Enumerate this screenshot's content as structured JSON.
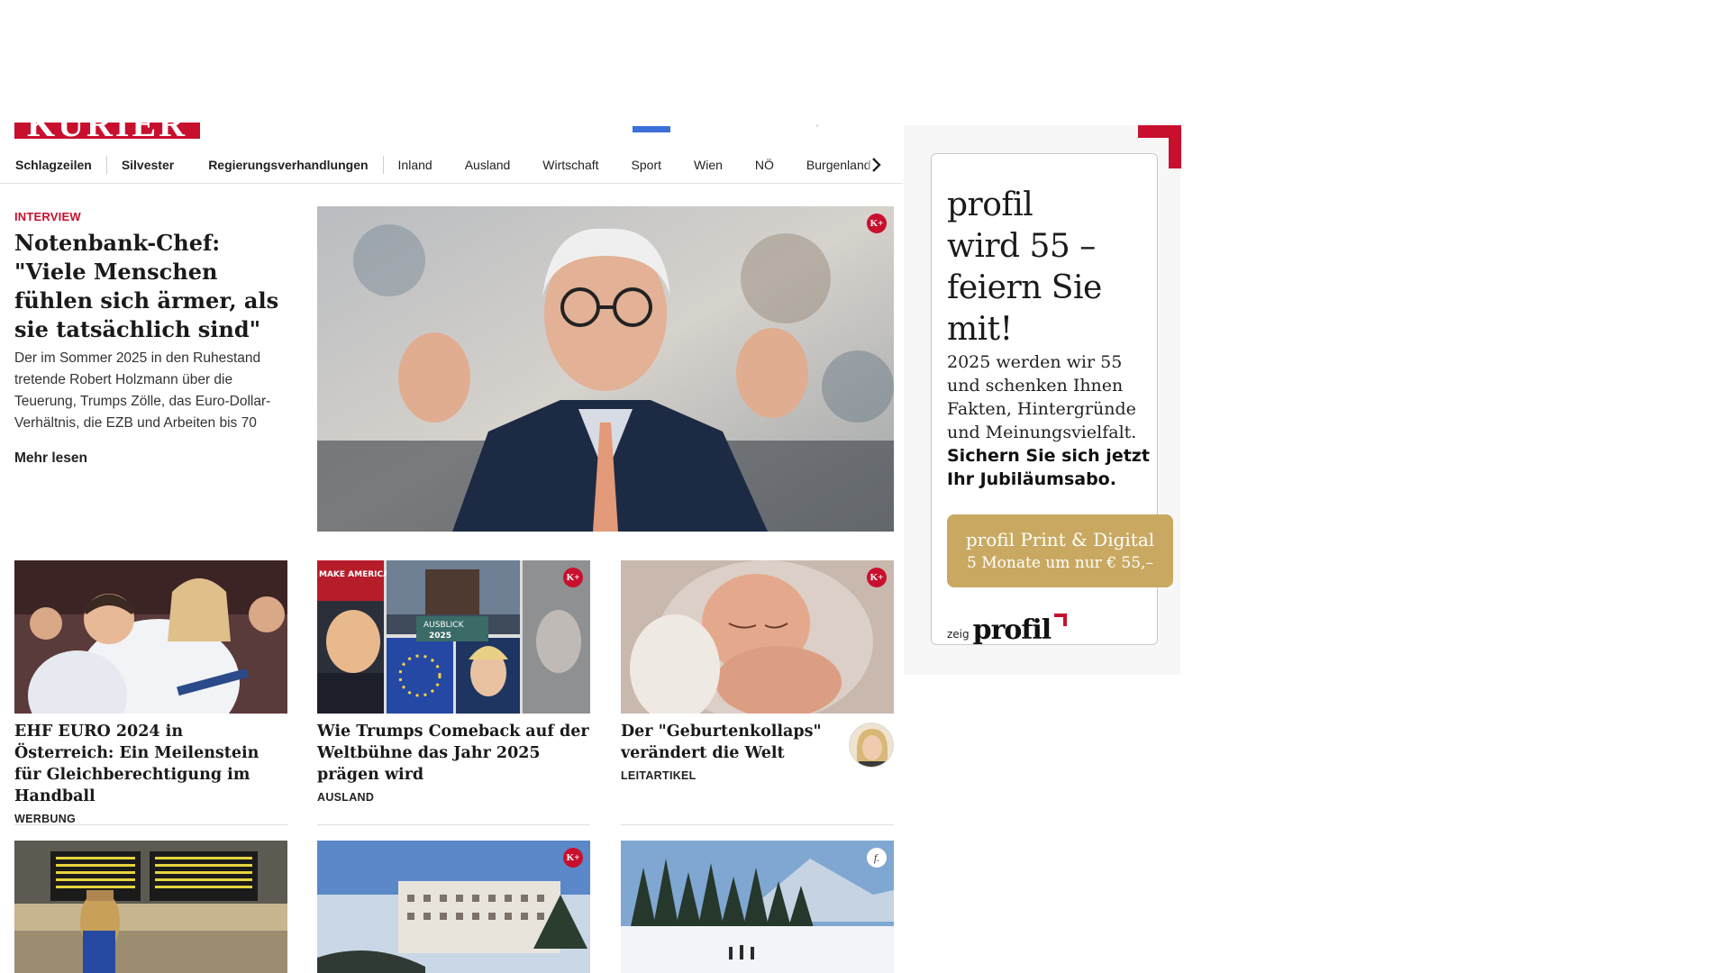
{
  "header": {
    "logo_text": "KURIER"
  },
  "nav": {
    "items": [
      {
        "label": "Schlagzeilen"
      },
      {
        "label": "Silvester"
      },
      {
        "label": "Regierungsverhandlungen"
      },
      {
        "label": "Inland"
      },
      {
        "label": "Ausland"
      },
      {
        "label": "Wirtschaft"
      },
      {
        "label": "Sport"
      },
      {
        "label": "Wien"
      },
      {
        "label": "NÖ"
      },
      {
        "label": "Burgenland"
      }
    ],
    "next_icon": "chevron-right-icon"
  },
  "hero": {
    "kicker": "INTERVIEW",
    "title": "Notenbank-Chef: \"Viele Menschen fühlen sich är­mer, als sie tatsächlich sind\"",
    "teaser": "Der im Sommer 2025 in den Ruhestand tretende Robert Holzmann über die Teuerung, Trumps Zölle, das Euro-Dollar-Verhältnis, die EZB und Arbeiten bis 70",
    "more": "Mehr lesen",
    "badge": "K+"
  },
  "cards": [
    {
      "title": "EHF EURO 2024 in Österreich: Ein Meilenstein für Gleichberechti­gung im Handball",
      "tag": "WERBUNG",
      "badge": ""
    },
    {
      "title": "Wie Trumps Comeback auf der Weltbühne das Jahr 2025 prägen wird",
      "tag": "AUSLAND",
      "badge": "K+",
      "image_text_1": "MAKE AMERICA GREAT AGAIN",
      "image_text_2": "AUSBLICK",
      "image_text_3": "2025"
    },
    {
      "title": "Der \"Geburtenkollaps\" ver­ändert die Welt",
      "tag": "LEITARTIKEL",
      "badge": "K+"
    }
  ],
  "row3": [
    {
      "badge": ""
    },
    {
      "badge": "K+"
    },
    {
      "badge": "f."
    }
  ],
  "ad": {
    "headline_1": "profil",
    "headline_2": "wird 55 –",
    "headline_3": "feiern Sie mit!",
    "body": "2025 werden wir 55 und schenken Ihnen Fakten, Hintergründe und Meinungsvielfalt.",
    "strong": "Sichern Sie sich jetzt Ihr Jubiläumsabo.",
    "button_line_1": "profil Print & Digital",
    "button_line_2": "5 Monate um nur € 55,–",
    "footer_prefix": "zeig",
    "footer_brand": "profil",
    "colors": {
      "gold": "#c9a961",
      "red": "#c8102e"
    }
  }
}
